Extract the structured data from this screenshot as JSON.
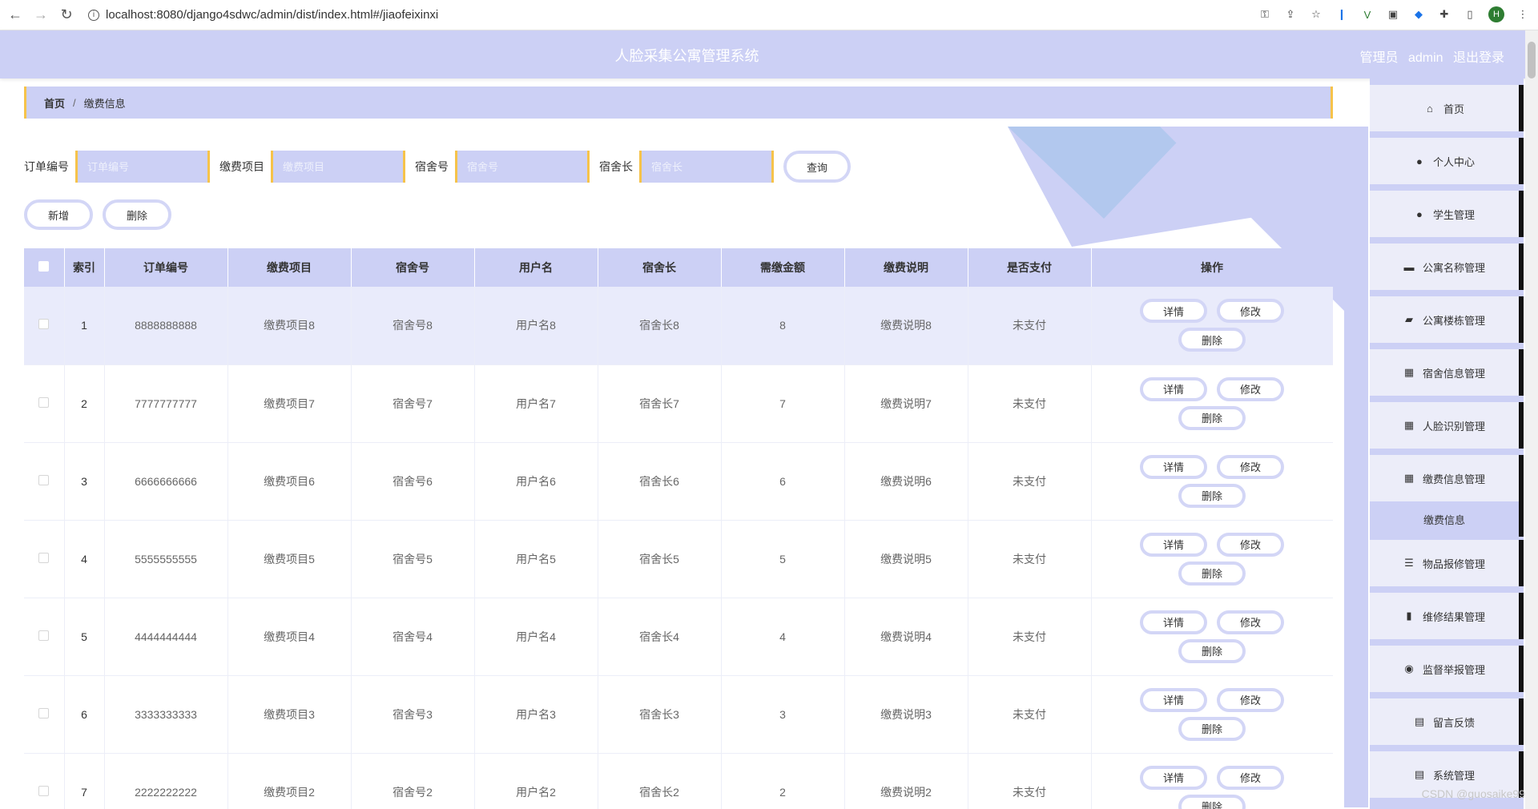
{
  "browser": {
    "url": "localhost:8080/django4sdwc/admin/dist/index.html#/jiaofeixinxi",
    "avatar_initial": "H"
  },
  "header": {
    "title": "人脸采集公寓管理系统",
    "role": "管理员",
    "username": "admin",
    "logout": "退出登录"
  },
  "breadcrumb": {
    "home": "首页",
    "current": "缴费信息"
  },
  "search": {
    "order_label": "订单编号",
    "order_placeholder": "订单编号",
    "item_label": "缴费项目",
    "item_placeholder": "缴费项目",
    "dorm_label": "宿舍号",
    "dorm_placeholder": "宿舍号",
    "leader_label": "宿舍长",
    "leader_placeholder": "宿舍长",
    "query": "查询"
  },
  "actions": {
    "add": "新增",
    "delete": "删除"
  },
  "table": {
    "headers": [
      "索引",
      "订单编号",
      "缴费项目",
      "宿舍号",
      "用户名",
      "宿舍长",
      "需缴金额",
      "缴费说明",
      "是否支付",
      "操作"
    ],
    "op_detail": "详情",
    "op_edit": "修改",
    "op_delete": "删除",
    "rows": [
      {
        "idx": "1",
        "order": "8888888888",
        "item": "缴费项目8",
        "dorm": "宿舍号8",
        "user": "用户名8",
        "leader": "宿舍长8",
        "amount": "8",
        "note": "缴费说明8",
        "paid": "未支付"
      },
      {
        "idx": "2",
        "order": "7777777777",
        "item": "缴费项目7",
        "dorm": "宿舍号7",
        "user": "用户名7",
        "leader": "宿舍长7",
        "amount": "7",
        "note": "缴费说明7",
        "paid": "未支付"
      },
      {
        "idx": "3",
        "order": "6666666666",
        "item": "缴费项目6",
        "dorm": "宿舍号6",
        "user": "用户名6",
        "leader": "宿舍长6",
        "amount": "6",
        "note": "缴费说明6",
        "paid": "未支付"
      },
      {
        "idx": "4",
        "order": "5555555555",
        "item": "缴费项目5",
        "dorm": "宿舍号5",
        "user": "用户名5",
        "leader": "宿舍长5",
        "amount": "5",
        "note": "缴费说明5",
        "paid": "未支付"
      },
      {
        "idx": "5",
        "order": "4444444444",
        "item": "缴费项目4",
        "dorm": "宿舍号4",
        "user": "用户名4",
        "leader": "宿舍长4",
        "amount": "4",
        "note": "缴费说明4",
        "paid": "未支付"
      },
      {
        "idx": "6",
        "order": "3333333333",
        "item": "缴费项目3",
        "dorm": "宿舍号3",
        "user": "用户名3",
        "leader": "宿舍长3",
        "amount": "3",
        "note": "缴费说明3",
        "paid": "未支付"
      },
      {
        "idx": "7",
        "order": "2222222222",
        "item": "缴费项目2",
        "dorm": "宿舍号2",
        "user": "用户名2",
        "leader": "宿舍长2",
        "amount": "2",
        "note": "缴费说明2",
        "paid": "未支付"
      }
    ]
  },
  "sidebar": {
    "items": [
      {
        "label": "首页",
        "icon": "home-icon",
        "glyph": "⌂"
      },
      {
        "label": "个人中心",
        "icon": "user-icon",
        "glyph": "●"
      },
      {
        "label": "学生管理",
        "icon": "user-icon",
        "glyph": "●"
      },
      {
        "label": "公寓名称管理",
        "icon": "chat-icon",
        "glyph": "▬"
      },
      {
        "label": "公寓楼栋管理",
        "icon": "briefcase-icon",
        "glyph": "▰"
      },
      {
        "label": "宿舍信息管理",
        "icon": "grid-icon",
        "glyph": "▦"
      },
      {
        "label": "人脸识别管理",
        "icon": "grid-icon",
        "glyph": "▦"
      },
      {
        "label": "缴费信息管理",
        "icon": "grid-icon",
        "glyph": "▦"
      },
      {
        "label": "物品报修管理",
        "icon": "sliders-icon",
        "glyph": "☰"
      },
      {
        "label": "维修结果管理",
        "icon": "book-icon",
        "glyph": "▮"
      },
      {
        "label": "监督举报管理",
        "icon": "pin-icon",
        "glyph": "◉"
      },
      {
        "label": "留言反馈",
        "icon": "clipboard-icon",
        "glyph": "▤"
      },
      {
        "label": "系统管理",
        "icon": "clipboard-check-icon",
        "glyph": "▤"
      }
    ],
    "active_sub": "缴费信息"
  },
  "watermark": "CSDN @guosaike99"
}
